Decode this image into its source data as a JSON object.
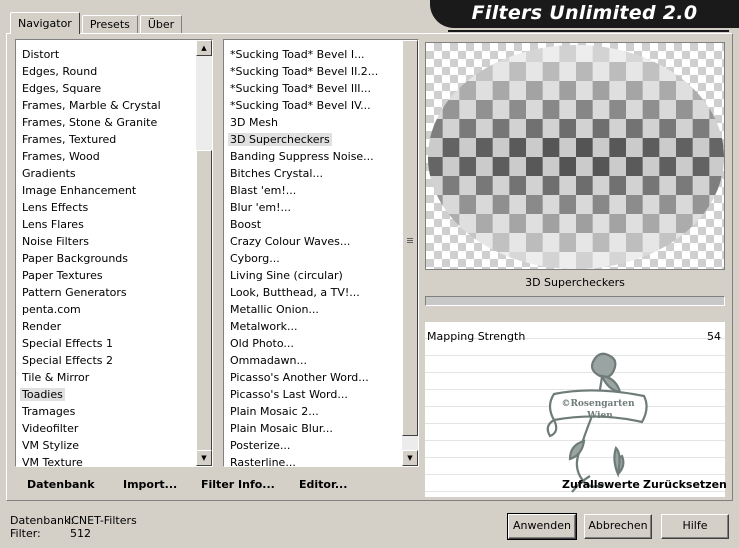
{
  "title": "Filters Unlimited 2.0",
  "tabs": [
    {
      "label": "Navigator",
      "active": true
    },
    {
      "label": "Presets",
      "active": false
    },
    {
      "label": "Über",
      "active": false
    }
  ],
  "categories": {
    "items": [
      "Distort",
      "Edges, Round",
      "Edges, Square",
      "Frames, Marble & Crystal",
      "Frames, Stone & Granite",
      "Frames, Textured",
      "Frames, Wood",
      "Gradients",
      "Image Enhancement",
      "Lens Effects",
      "Lens Flares",
      "Noise Filters",
      "Paper Backgrounds",
      "Paper Textures",
      "Pattern Generators",
      "penta.com",
      "Render",
      "Special Effects 1",
      "Special Effects 2",
      "Tile & Mirror",
      "Toadies",
      "Tramages",
      "Videofilter",
      "VM Stylize",
      "VM Texture"
    ],
    "selected_index": 20
  },
  "filters": {
    "items": [
      "*Sucking Toad*  Bevel I...",
      "*Sucking Toad*  Bevel II.2...",
      "*Sucking Toad*  Bevel III...",
      "*Sucking Toad*  Bevel IV...",
      "3D Mesh",
      "3D Supercheckers",
      "Banding Suppress Noise...",
      "Bitches Crystal...",
      "Blast 'em!...",
      "Blur 'em!...",
      "Boost",
      "Crazy Colour Waves...",
      "Cyborg...",
      "Living Sine (circular)",
      "Look, Butthead, a TV!...",
      "Metallic Onion...",
      "Metalwork...",
      "Old Photo...",
      "Ommadawn...",
      "Picasso's Another Word...",
      "Picasso's Last Word...",
      "Plain Mosaic 2...",
      "Plain Mosaic Blur...",
      "Posterize...",
      "Rasterline..."
    ],
    "selected_index": 5
  },
  "preview": {
    "filter_name": "3D Supercheckers",
    "progress": 0
  },
  "parameters": [
    {
      "label": "Mapping Strength",
      "value": "54"
    }
  ],
  "watermark": {
    "line1": "©Rosengarten",
    "line2": "Wien"
  },
  "toolbar": {
    "datenbank": "Datenbank",
    "import": "Import...",
    "filter_info": "Filter Info...",
    "editor": "Editor...",
    "zufallswerte": "Zufallswerte",
    "zuruecksetzen": "Zurücksetzen"
  },
  "status": {
    "db_label": "Datenbank:",
    "db_value": "ICNET-Filters",
    "filter_label": "Filter:",
    "filter_value": "512"
  },
  "buttons": {
    "apply": "Anwenden",
    "cancel": "Abbrechen",
    "help": "Hilfe"
  },
  "colors": {
    "face": "#d4d0c8",
    "banner": "#1a1a1a",
    "watermark": "#6e7b79"
  }
}
